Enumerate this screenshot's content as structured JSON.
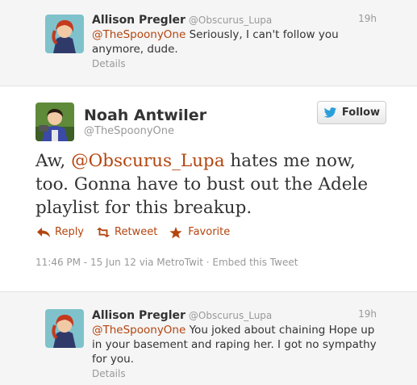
{
  "replies": [
    {
      "name": "Allison Pregler",
      "handle": "@Obscurus_Lupa",
      "time": "19h",
      "mention": "@TheSpoonyOne",
      "text": " Seriously, I can't follow you anymore, dude.",
      "details": "Details"
    },
    {
      "name": "Allison Pregler",
      "handle": "@Obscurus_Lupa",
      "time": "19h",
      "mention": "@TheSpoonyOne",
      "text": " You joked about chaining Hope up in your basement and raping her. I got no sympathy for you.",
      "details": "Details"
    }
  ],
  "main_tweet": {
    "name": "Noah Antwiler",
    "handle": "@TheSpoonyOne",
    "follow_label": "Follow",
    "text_before": "Aw, ",
    "mention": "@Obscurus_Lupa",
    "text_after": " hates me now, too. Gonna have to bust out the Adele playlist for this breakup.",
    "actions": {
      "reply": "Reply",
      "retweet": "Retweet",
      "favorite": "Favorite"
    },
    "timestamp": "11:46 PM - 15 Jun 12",
    "via": " via MetroTwit · ",
    "embed": "Embed this Tweet"
  },
  "colors": {
    "accent": "#b4450f",
    "twitter_blue": "#2b9fd9"
  },
  "icons": [
    "reply-icon",
    "retweet-icon",
    "favorite-icon",
    "twitter-bird-icon"
  ]
}
